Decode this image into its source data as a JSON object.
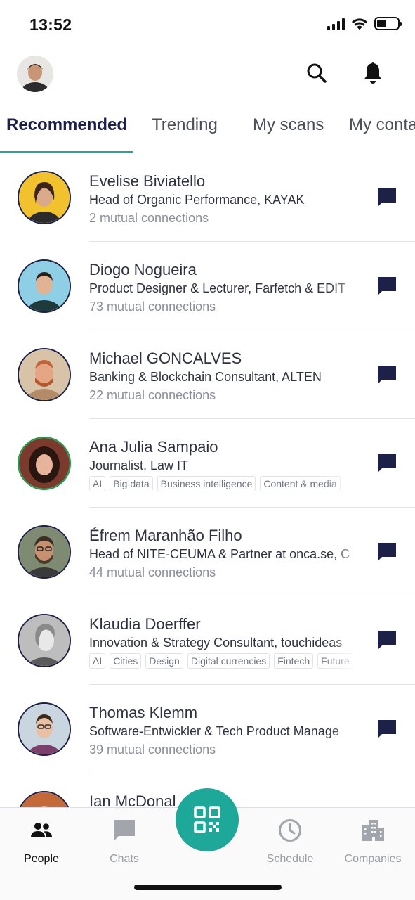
{
  "status_bar": {
    "time": "13:52",
    "battery_level": 0.45
  },
  "header": {
    "avatar": "profile-avatar",
    "search_icon": "search-icon",
    "bell_icon": "bell-icon"
  },
  "tabs": [
    {
      "label": "Recommended",
      "active": true
    },
    {
      "label": "Trending"
    },
    {
      "label": "My scans"
    },
    {
      "label": "My conta"
    }
  ],
  "people": [
    {
      "name": "Evelise Biviatello",
      "title": "Head of Organic Performance, KAYAK",
      "meta": "2 mutual connections",
      "avatar_color": "#f2c12e"
    },
    {
      "name": "Diogo Nogueira",
      "title": "Product Designer & Lecturer, Farfetch & EDIT",
      "meta": "73 mutual connections",
      "avatar_color": "#8ecfe6"
    },
    {
      "name": "Michael GONCALVES",
      "title": "Banking & Blockchain  Consultant, ALTEN",
      "meta": "22 mutual connections",
      "avatar_color": "#d9c3a8"
    },
    {
      "name": "Ana Julia Sampaio",
      "title": "Journalist, Law IT",
      "tags": [
        "AI",
        "Big data",
        "Business intelligence",
        "Content & media"
      ],
      "avatar_color": "#7a3b2e",
      "ring": "green"
    },
    {
      "name": "Éfrem Maranhão Filho",
      "title": "Head of NITE-CEUMA & Partner at onca.se, C",
      "meta": "44 mutual connections",
      "avatar_color": "#7f8a72"
    },
    {
      "name": "Klaudia Doerffer",
      "title": "Innovation & Strategy Consultant, touchideas",
      "tags": [
        "AI",
        "Cities",
        "Design",
        "Digital currencies",
        "Fintech",
        "Future"
      ],
      "avatar_color": "#bdbdbd"
    },
    {
      "name": "Thomas Klemm",
      "title": "Software-Entwickler & Tech Product Manage",
      "meta": "39 mutual connections",
      "avatar_color": "#c9d6e0"
    },
    {
      "name": "Ian McDonal",
      "title": "",
      "meta": "",
      "avatar_color": "#c46a3a"
    }
  ],
  "bottom_nav": [
    {
      "label": "People",
      "icon": "people-icon",
      "active": true
    },
    {
      "label": "Chats",
      "icon": "chat-icon"
    },
    {
      "label": "Schedule",
      "icon": "clock-icon"
    },
    {
      "label": "Companies",
      "icon": "building-icon"
    }
  ],
  "fab_icon": "qr-code-icon",
  "colors": {
    "accent": "#1ea89a",
    "navy": "#1e2147",
    "active_ring": "#16a34a"
  }
}
